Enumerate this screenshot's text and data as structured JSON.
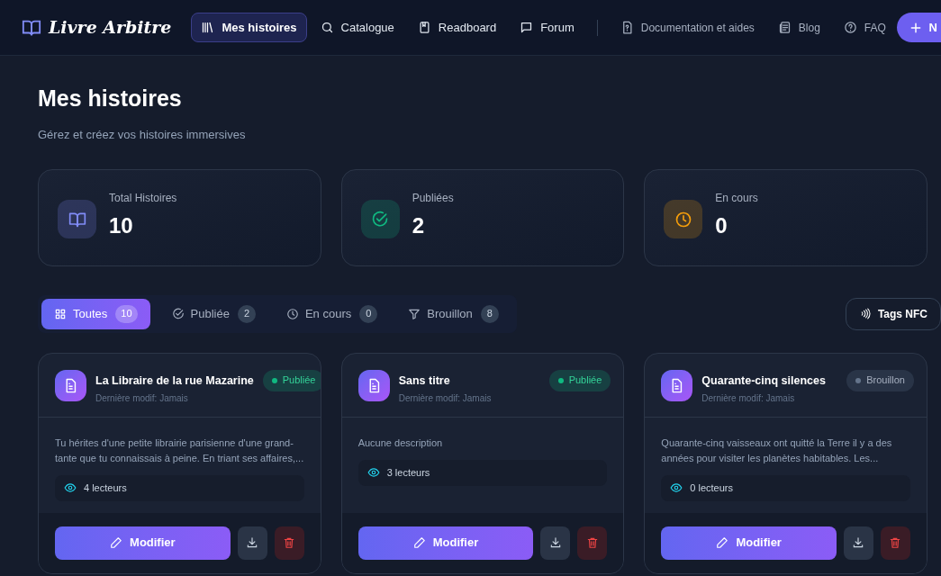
{
  "brand": "Livre Arbitre",
  "nav": [
    {
      "label": "Mes histoires",
      "selected": true
    },
    {
      "label": "Catalogue",
      "selected": false
    },
    {
      "label": "Readboard",
      "selected": false
    },
    {
      "label": "Forum",
      "selected": false
    },
    {
      "label": "Documentation et aides",
      "selected": false
    },
    {
      "label": "Blog",
      "selected": false
    },
    {
      "label": "FAQ",
      "selected": false
    }
  ],
  "new_button": "N",
  "page": {
    "title": "Mes histoires",
    "subtitle": "Gérez et créez vos histoires immersives"
  },
  "stats": [
    {
      "label": "Total Histoires",
      "value": "10",
      "color": "#818cf8"
    },
    {
      "label": "Publiées",
      "value": "2",
      "color": "#10b981"
    },
    {
      "label": "En cours",
      "value": "0",
      "color": "#f59e0b"
    }
  ],
  "filters": [
    {
      "label": "Toutes",
      "count": "10",
      "selected": true
    },
    {
      "label": "Publiée",
      "count": "2",
      "selected": false
    },
    {
      "label": "En cours",
      "count": "0",
      "selected": false
    },
    {
      "label": "Brouillon",
      "count": "8",
      "selected": false
    }
  ],
  "nfc_button": "Tags NFC",
  "stories": [
    {
      "title": "La Libraire de la rue Mazarine",
      "modified": "Dernière modif: Jamais",
      "status": {
        "kind": "published",
        "label": "Publiée"
      },
      "description": "Tu hérites d'une petite librairie parisienne d'une grand-tante que tu connaissais à peine. En triant ses affaires,...",
      "readers": "4 lecteurs",
      "edit": "Modifier"
    },
    {
      "title": "Sans titre",
      "modified": "Dernière modif: Jamais",
      "status": {
        "kind": "published",
        "label": "Publiée"
      },
      "description": "Aucune description",
      "readers": "3 lecteurs",
      "edit": "Modifier"
    },
    {
      "title": "Quarante-cinq silences",
      "modified": "Dernière modif: Jamais",
      "status": {
        "kind": "draft",
        "label": "Brouillon"
      },
      "description": "Quarante-cinq vaisseaux ont quitté la Terre il y a des années pour visiter les planètes habitables. Les...",
      "readers": "0 lecteurs",
      "edit": "Modifier"
    }
  ]
}
